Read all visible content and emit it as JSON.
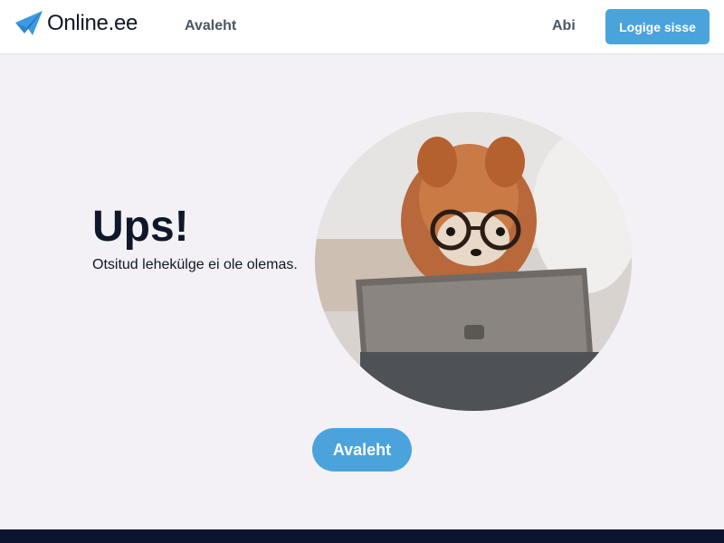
{
  "header": {
    "logo_text": "Online.ee",
    "nav_home": "Avaleht",
    "nav_help": "Abi",
    "login_button": "Logige sisse"
  },
  "main": {
    "headline": "Ups!",
    "message": "Otsitud lehekülge ei ole olemas.",
    "image_alt": "Koer prillidega tahvelarvuti taga",
    "home_button": "Avaleht"
  },
  "colors": {
    "accent": "#4ba3dc",
    "footer": "#0b1530",
    "background": "#f3f1f5"
  },
  "icons": {
    "logo": "paper-plane-icon"
  }
}
